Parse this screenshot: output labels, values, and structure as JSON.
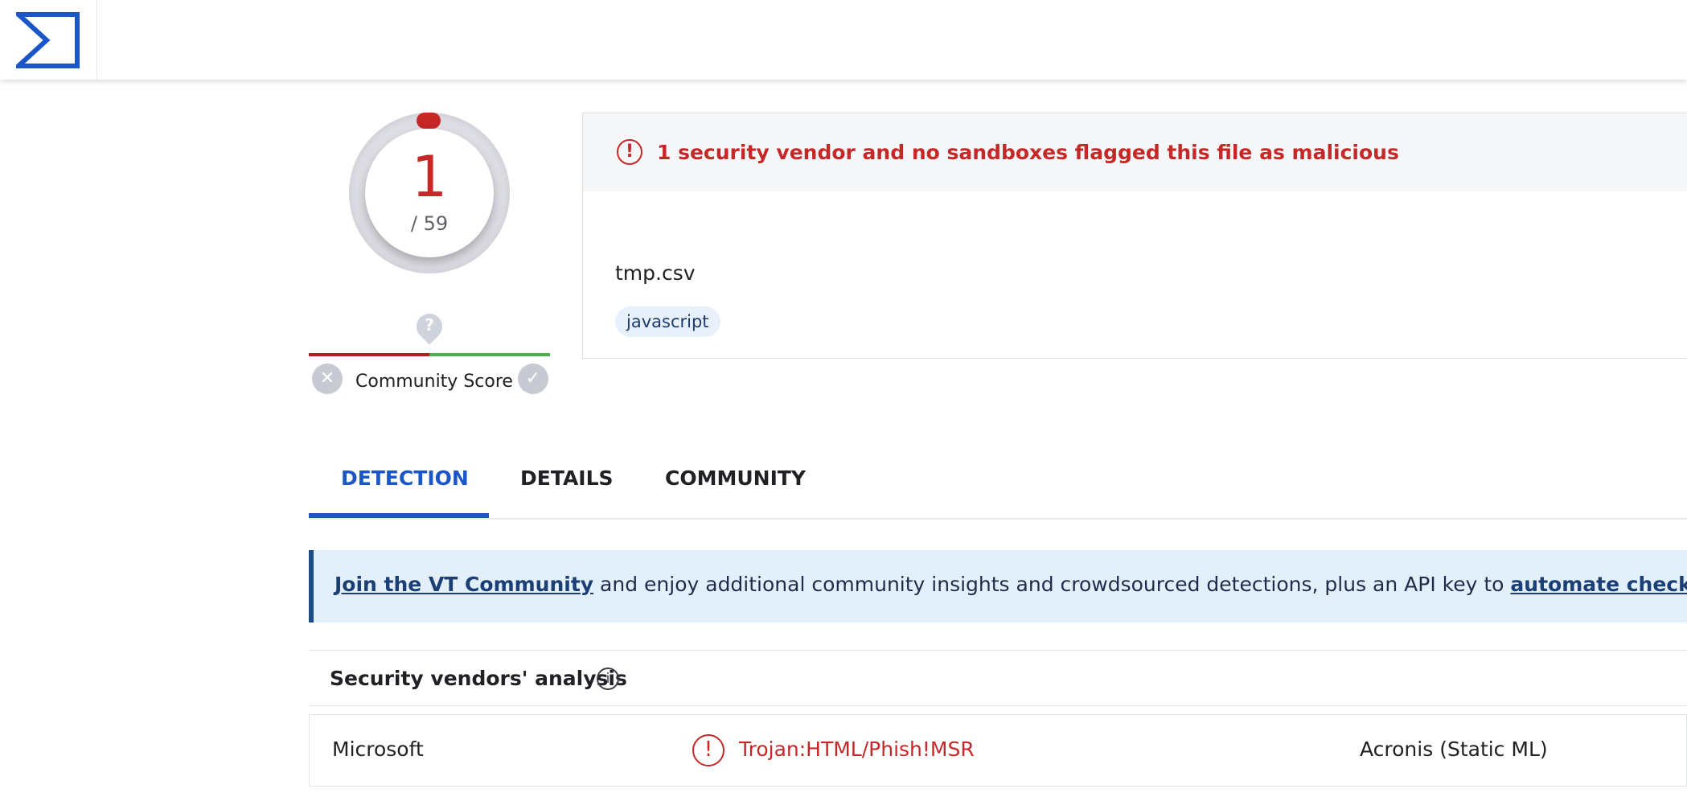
{
  "score": {
    "detections": "1",
    "total": "/ 59"
  },
  "community": {
    "label": "Community Score",
    "question_icon": "question-pin-icon",
    "negative_icon": "close-icon",
    "positive_icon": "check-icon"
  },
  "alert": {
    "text": "1 security vendor and no sandboxes flagged this file as malicious"
  },
  "file": {
    "name": "tmp.csv",
    "tags": [
      "javascript"
    ]
  },
  "tabs": [
    {
      "label": "DETECTION",
      "active": true
    },
    {
      "label": "DETAILS",
      "active": false
    },
    {
      "label": "COMMUNITY",
      "active": false
    }
  ],
  "join_banner": {
    "link1": "Join the VT Community",
    "middle": " and enjoy additional community insights and crowdsourced detections, plus an API key to ",
    "link2": "automate checks."
  },
  "vendors": {
    "title": "Security vendors' analysis",
    "rows": [
      {
        "vendor": "Microsoft",
        "result": "Trojan:HTML/Phish!MSR",
        "vendor2": "Acronis (Static ML)"
      }
    ]
  },
  "colors": {
    "malicious": "#c62828",
    "accent": "#1a56c7",
    "banner_bg": "#e3f0fb"
  }
}
